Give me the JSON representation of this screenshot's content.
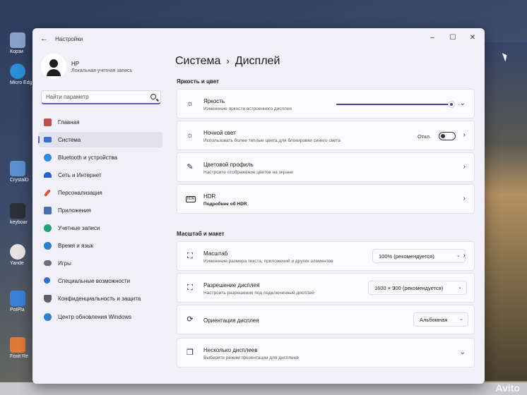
{
  "desktop": {
    "icons": [
      {
        "label": "Корзи"
      },
      {
        "label": "Micro Edg"
      },
      {
        "label": "CrystalD"
      },
      {
        "label": "keyboar"
      },
      {
        "label": "Yande"
      },
      {
        "label": "PotPla"
      },
      {
        "label": "Foxit Re"
      }
    ],
    "watermark": "Avito"
  },
  "window": {
    "app_title": "Настройки",
    "controls": {
      "minimize": "–",
      "maximize": "☐",
      "close": "✕"
    }
  },
  "profile": {
    "name": "HP",
    "subtitle": "Локальная учетная запись"
  },
  "search": {
    "placeholder": "Найти параметр"
  },
  "sidebar": {
    "items": [
      {
        "label": "Главная",
        "color": "#c0504d"
      },
      {
        "label": "Система",
        "color": "#3a6fd8"
      },
      {
        "label": "Bluetooth и устройства",
        "color": "#2f8be0"
      },
      {
        "label": "Сеть и Интернет",
        "color": "#2563c9"
      },
      {
        "label": "Персонализация",
        "color": "#d9553d"
      },
      {
        "label": "Приложения",
        "color": "#4a6fb0"
      },
      {
        "label": "Учетные записи",
        "color": "#2aa07a"
      },
      {
        "label": "Время и язык",
        "color": "#2f7fd0"
      },
      {
        "label": "Игры",
        "color": "#6b6f7a"
      },
      {
        "label": "Специальные возможности",
        "color": "#2f6fd0"
      },
      {
        "label": "Конфиденциальность и защита",
        "color": "#5a5f6a"
      },
      {
        "label": "Центр обновления Windows",
        "color": "#2f7fd0"
      }
    ]
  },
  "main": {
    "breadcrumb": {
      "parent": "Система",
      "separator": "›",
      "current": "Дисплей"
    },
    "section_brightness": "Яркость и цвет",
    "brightness": {
      "title": "Яркость",
      "subtitle": "Изменение яркости встроенного дисплея",
      "level_percent": 100
    },
    "night_light": {
      "title": "Ночной свет",
      "subtitle": "Использовать более теплые цвета для блокировки синего света",
      "state": "Откл."
    },
    "color_profile": {
      "title": "Цветовой профиль",
      "subtitle": "Настроите отображение цветов на экране"
    },
    "hdr": {
      "title": "HDR",
      "subtitle": "Подробнее об HDR",
      "icon_text": "HDR"
    },
    "section_scale": "Масштаб и макет",
    "scale": {
      "title": "Масштаб",
      "subtitle": "Изменение размера текста, приложений и других элементов",
      "value": "100% (рекомендуется)"
    },
    "resolution": {
      "title": "Разрешение дисплея",
      "subtitle": "Настроить разрешение под подключенный дисплей",
      "value": "1600 × 900 (рекомендуется)"
    },
    "orientation": {
      "title": "Ориентация дисплея",
      "value": "Альбомная"
    },
    "multiple": {
      "title": "Несколько дисплеев",
      "subtitle": "Выберите режим презентации для дисплеев"
    }
  }
}
